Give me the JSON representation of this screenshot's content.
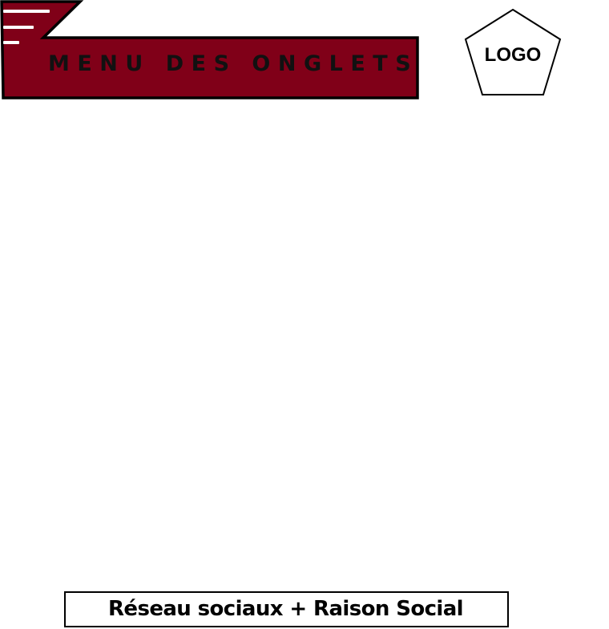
{
  "header": {
    "menu_title": "MENU DES ONGLETS",
    "menu_icon": "hamburger-menu-icon",
    "logo_text": "LOGO"
  },
  "footer": {
    "text": "Réseau sociaux + Raison Social"
  },
  "colors": {
    "banner": "#800018",
    "outline": "#000000",
    "background": "#ffffff"
  }
}
